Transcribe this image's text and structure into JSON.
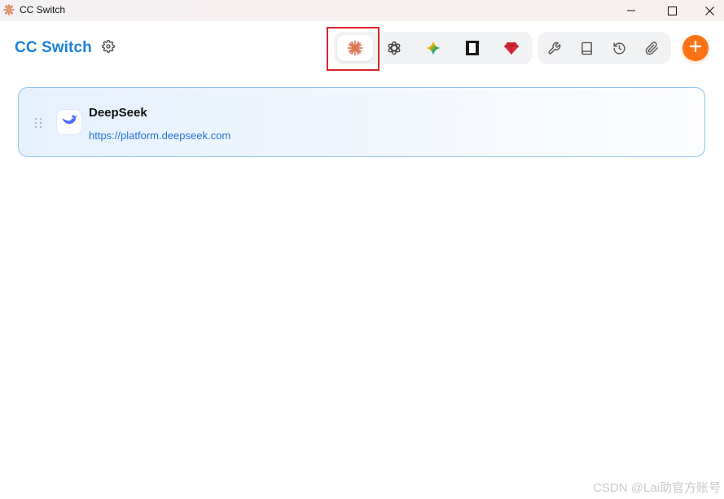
{
  "window": {
    "title": "CC Switch",
    "controls": [
      "minimize",
      "maximize",
      "close"
    ]
  },
  "header": {
    "brand": "CC Switch",
    "settings_icon": "gear-icon"
  },
  "app_tabs": [
    {
      "id": "claude",
      "icon": "claude-icon",
      "active": true,
      "color": "#d97757"
    },
    {
      "id": "openai",
      "icon": "openai-icon",
      "active": false,
      "color": "#444444"
    },
    {
      "id": "gemini",
      "icon": "gemini-icon",
      "active": false,
      "color": "#4a8af4"
    },
    {
      "id": "opencode",
      "icon": "opencode-icon",
      "active": false,
      "color": "#1a1a1a"
    },
    {
      "id": "ruby",
      "icon": "ruby-icon",
      "active": false,
      "color": "#d92b3a"
    }
  ],
  "tools": [
    {
      "id": "wrench",
      "icon": "wrench-icon"
    },
    {
      "id": "book",
      "icon": "book-icon"
    },
    {
      "id": "history",
      "icon": "history-icon"
    },
    {
      "id": "paperclip",
      "icon": "paperclip-icon"
    }
  ],
  "add_button": {
    "icon": "plus-icon",
    "color": "#f97316"
  },
  "providers": [
    {
      "name": "DeepSeek",
      "url": "https://platform.deepseek.com",
      "icon": "deepseek-icon",
      "selected": true
    }
  ],
  "accent_color": "#1a82dc",
  "watermark": "CSDN @Lai助官方账号"
}
